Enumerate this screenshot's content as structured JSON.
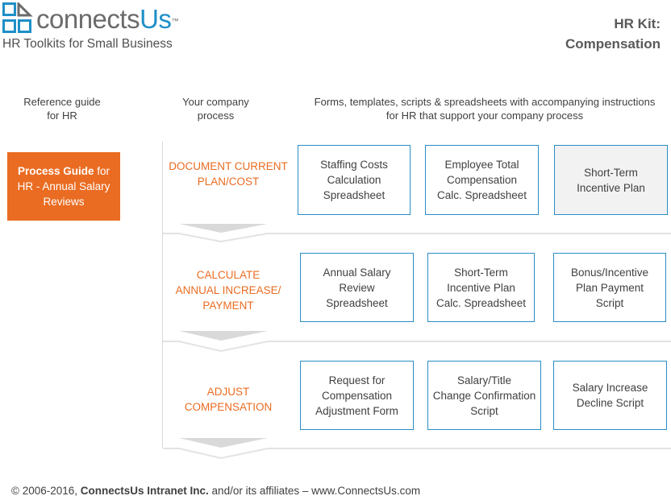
{
  "header": {
    "logo": {
      "brand_prefix": "connects",
      "brand_suffix": "Us",
      "trademark": "™",
      "icon": "connectsus-logo-icon"
    },
    "tagline": "HR Toolkits for Small Business",
    "kit_title_line1": "HR Kit:",
    "kit_title_line2": "Compensation"
  },
  "columns": {
    "reference": {
      "line1": "Reference guide",
      "line2": "for HR"
    },
    "process": {
      "line1": "Your company",
      "line2": "process"
    },
    "tools": {
      "line1": "Forms, templates, scripts & spreadsheets with accompanying instructions",
      "line2": "for HR that support your company process"
    }
  },
  "process_guide": {
    "bold": "Process Guide",
    "rest1": " for",
    "line2": "HR - Annual Salary",
    "line3": "Reviews"
  },
  "stages": [
    {
      "label_lines": [
        "DOCUMENT CURRENT",
        "PLAN/COST"
      ],
      "items": [
        {
          "lines": [
            "Staffing Costs",
            "Calculation",
            "Spreadsheet"
          ]
        },
        {
          "lines": [
            "Employee Total",
            "Compensation",
            "Calc. Spreadsheet"
          ]
        },
        {
          "lines": [
            "Short-Term",
            "Incentive Plan"
          ]
        }
      ]
    },
    {
      "label_lines": [
        "CALCULATE",
        "ANNUAL INCREASE/",
        "PAYMENT"
      ],
      "items": [
        {
          "lines": [
            "Annual Salary",
            "Review",
            "Spreadsheet"
          ]
        },
        {
          "lines": [
            "Short-Term",
            "Incentive Plan",
            "Calc. Spreadsheet"
          ]
        },
        {
          "lines": [
            "Bonus/Incentive",
            "Plan Payment",
            "Script"
          ]
        }
      ]
    },
    {
      "label_lines": [
        "ADJUST",
        "COMPENSATION"
      ],
      "items": [
        {
          "lines": [
            "Request for",
            "Compensation",
            "Adjustment Form"
          ]
        },
        {
          "lines": [
            "Salary/Title",
            "Change Confirmation",
            "Script"
          ]
        },
        {
          "lines": [
            "Salary Increase",
            "Decline Script"
          ]
        }
      ]
    }
  ],
  "footer": {
    "prefix": "© 2006-2016, ",
    "company": "ConnectsUs Intranet Inc.",
    "suffix": " and/or its affiliates – www.ConnectsUs.com"
  },
  "colors": {
    "accent_orange": "#ea6c22",
    "accent_blue": "#2a8dc5",
    "text": "#404040"
  }
}
